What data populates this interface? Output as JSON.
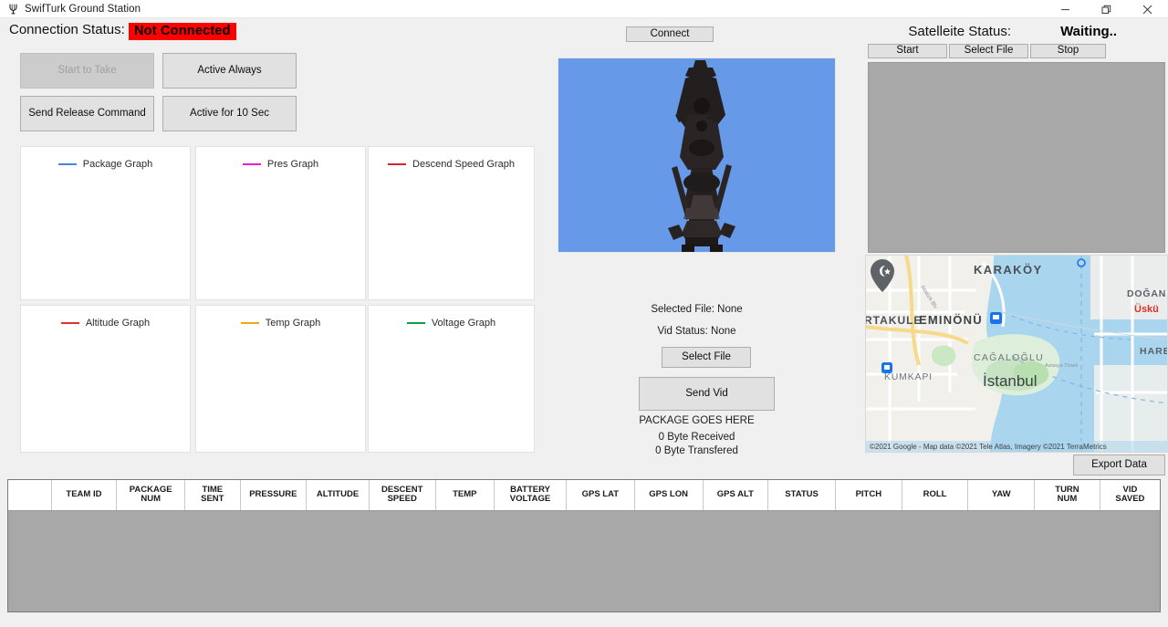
{
  "window": {
    "title": "SwifTurk Ground Station",
    "app_icon": "trident-icon",
    "controls": {
      "minimize": "minimize-icon",
      "maximize": "restore-icon",
      "close": "close-icon"
    }
  },
  "connection": {
    "label": "Connection Status:",
    "status": "Not Connected",
    "status_bg": "#ff0000",
    "status_fg": "#000000",
    "connect_button": "Connect"
  },
  "commands": {
    "start_to_take": "Start to Take",
    "start_to_take_enabled": false,
    "active_always": "Active Always",
    "send_release_command": "Send Release Command",
    "active_for_10_sec": "Active for 10 Sec"
  },
  "graphs": [
    {
      "label": "Package Graph",
      "color": "#4a86d8"
    },
    {
      "label": "Pres Graph",
      "color": "#f01ad0"
    },
    {
      "label": "Descend Speed Graph",
      "color": "#d62136"
    },
    {
      "label": "Altitude Graph",
      "color": "#e03131"
    },
    {
      "label": "Temp Graph",
      "color": "#f0a818"
    },
    {
      "label": "Voltage Graph",
      "color": "#0f9d45"
    }
  ],
  "video_panel": {
    "selected_file": "Selected File: None",
    "vid_status": "Vid Status: None",
    "select_file_button": "Select File",
    "send_vid_button": "Send Vid",
    "package_placeholder": "PACKAGE GOES HERE",
    "bytes_received": "0 Byte Received",
    "bytes_transferred": "0 Byte Transfered"
  },
  "satellite": {
    "label": "Satelleite Status:",
    "status": "Waiting..",
    "start_button": "Start",
    "select_file_button": "Select File",
    "stop_button": "Stop"
  },
  "map": {
    "attribution": "©2021 Google - Map data ©2021 Tele Atlas, Imagery ©2021 TerraMetrics",
    "labels": [
      "KARAKÖY",
      "EMINÖNÜ",
      "CAĞALOĞLU",
      "İstanbul",
      "DOĞAN",
      "Üskü",
      "RTAKULE",
      "KUMKAPI",
      "HARE"
    ],
    "marker_icon": "mosque-pin-icon"
  },
  "export": {
    "label": "Export Data"
  },
  "table": {
    "columns": [
      "",
      "TEAM ID",
      "PACKAGE\nNUM",
      "TIME\nSENT",
      "PRESSURE",
      "ALTITUDE",
      "DESCENT\nSPEED",
      "TEMP",
      "BATTERY\nVOLTAGE",
      "GPS LAT",
      "GPS LON",
      "GPS ALT",
      "STATUS",
      "PITCH",
      "ROLL",
      "YAW",
      "TURN\nNUM",
      "VID\nSAVED"
    ],
    "rows": []
  }
}
